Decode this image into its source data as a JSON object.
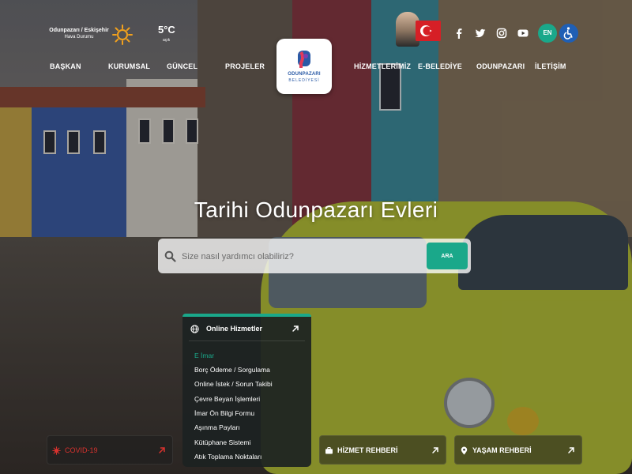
{
  "weather": {
    "location": "Odunpazarı / Eskişehir",
    "label": "Hava Durumu",
    "icon": "sun-icon",
    "temperature": "5°C",
    "condition": "açık"
  },
  "nav": {
    "left": [
      "BAŞKAN",
      "KURUMSAL",
      "GÜNCEL",
      "PROJELER"
    ],
    "right": [
      "HİZMETLERİMİZ",
      "E-BELEDİYE",
      "ODUNPAZARI",
      "İLETİŞİM"
    ]
  },
  "logo": {
    "line1": "ODUNPAZARI",
    "line2": "BELEDİYESİ"
  },
  "social": [
    "facebook-icon",
    "twitter-icon",
    "instagram-icon",
    "youtube-icon"
  ],
  "language_button": "EN",
  "accessibility_icon": "wheelchair-icon",
  "hero": {
    "title": "Tarihi Odunpazarı Evleri"
  },
  "search": {
    "placeholder": "Size nasıl yardımcı olabiliriz?",
    "button": "ARA"
  },
  "online_services": {
    "title": "Online Hizmetler",
    "items": [
      "E İmar",
      "Borç Ödeme / Sorgulama",
      "Online İstek / Sorun Takibi",
      "Çevre Beyan İşlemleri",
      "İmar Ön Bilgi Formu",
      "Aşınma Payları",
      "Kütüphane Sistemi",
      "Atık Toplama Noktaları"
    ],
    "active_index": 0
  },
  "bottom": {
    "covid": "COVID-19",
    "hizmet": "HİZMET REHBERİ",
    "yasam": "YAŞAM REHBERİ"
  },
  "colors": {
    "accent": "#1aa88a",
    "covid": "#d8322e",
    "flag": "#d61f26",
    "accessibility": "#1f5fb5"
  }
}
